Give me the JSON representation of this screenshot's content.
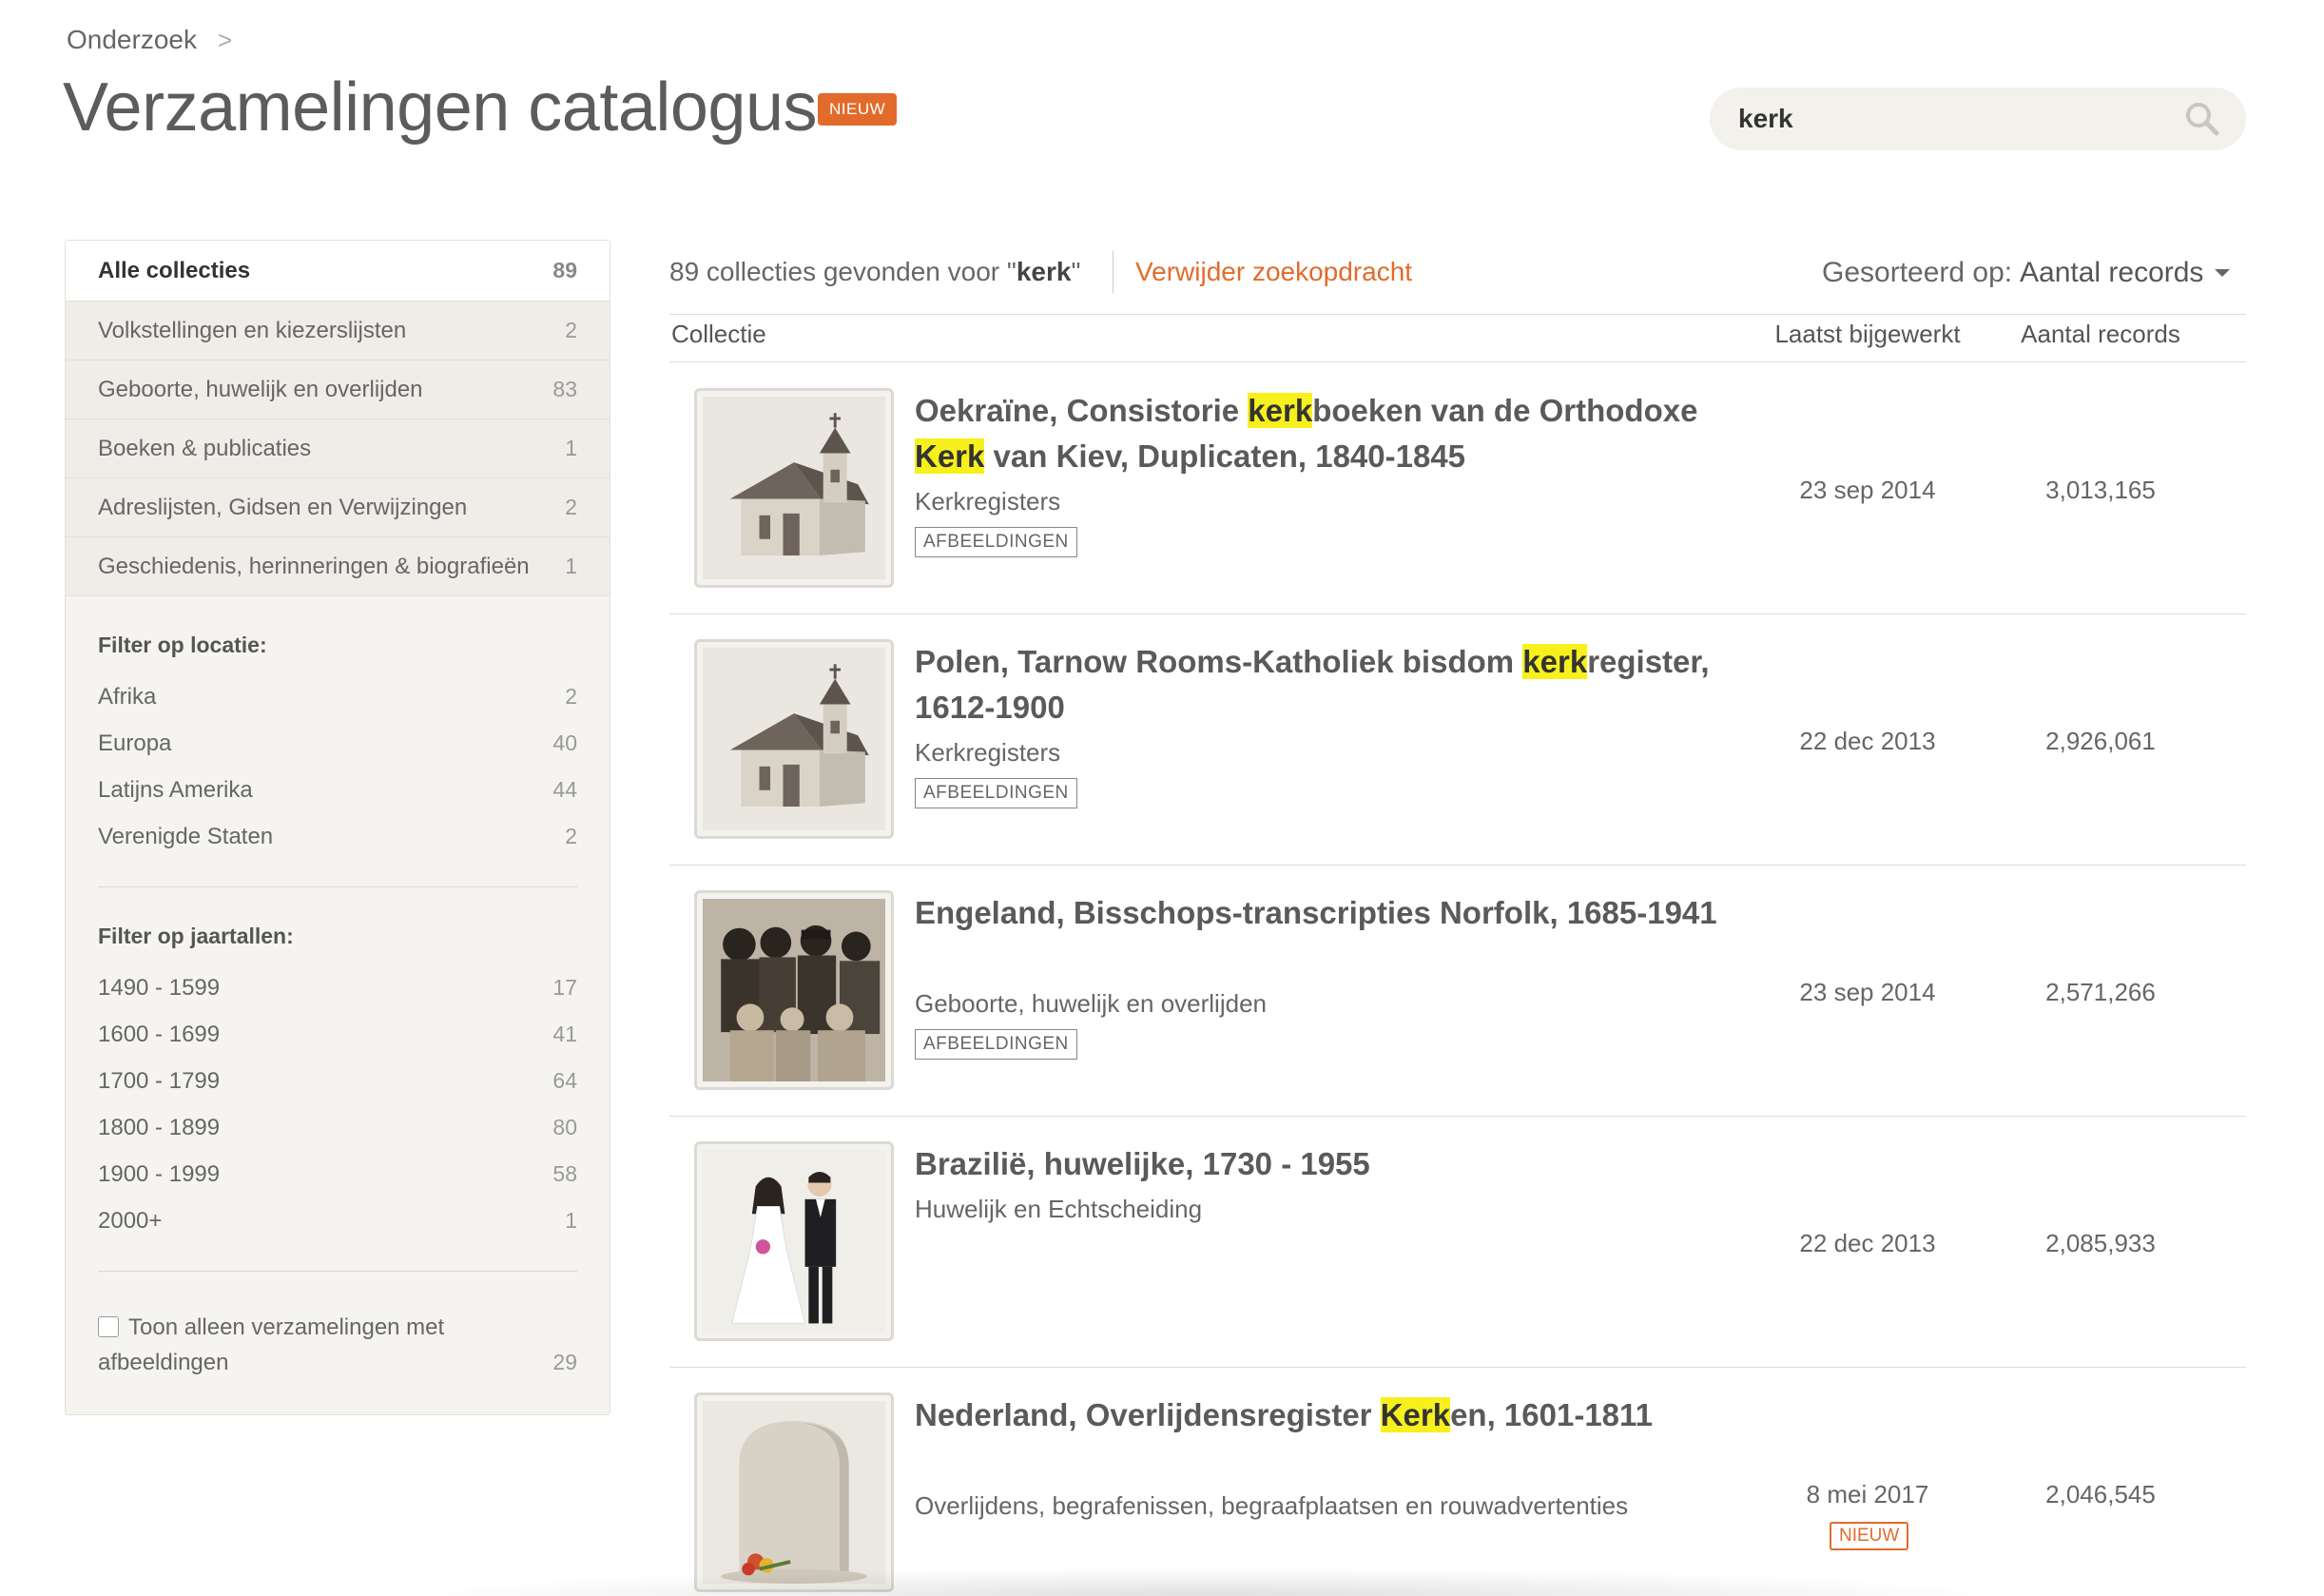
{
  "breadcrumb": {
    "label": "Onderzoek",
    "separator": ">"
  },
  "page": {
    "title": "Verzamelingen catalogus",
    "badge": "NIEUW"
  },
  "search": {
    "value": "kerk",
    "placeholder": ""
  },
  "sidebar": {
    "categories": [
      {
        "label": "Alle collecties",
        "count": "89"
      },
      {
        "label": "Volkstellingen en kiezerslijsten",
        "count": "2"
      },
      {
        "label": "Geboorte, huwelijk en overlijden",
        "count": "83"
      },
      {
        "label": "Boeken & publicaties",
        "count": "1"
      },
      {
        "label": "Adreslijsten, Gidsen en Verwijzingen",
        "count": "2"
      },
      {
        "label": "Geschiedenis, herinneringen & biografieën",
        "count": "1"
      }
    ],
    "location_heading": "Filter op locatie:",
    "locations": [
      {
        "label": "Afrika",
        "count": "2"
      },
      {
        "label": "Europa",
        "count": "40"
      },
      {
        "label": "Latijns Amerika",
        "count": "44"
      },
      {
        "label": "Verenigde Staten",
        "count": "2"
      }
    ],
    "years_heading": "Filter op jaartallen:",
    "years": [
      {
        "label": "1490 - 1599",
        "count": "17"
      },
      {
        "label": "1600 - 1699",
        "count": "41"
      },
      {
        "label": "1700 - 1799",
        "count": "64"
      },
      {
        "label": "1800 - 1899",
        "count": "80"
      },
      {
        "label": "1900 - 1999",
        "count": "58"
      },
      {
        "label": "2000+",
        "count": "1"
      }
    ],
    "images_only": {
      "line1": "Toon alleen verzamelingen met",
      "line2": "afbeeldingen",
      "count": "29"
    }
  },
  "results": {
    "count_prefix": "89 collecties gevonden voor \"",
    "query": "kerk",
    "count_suffix": "\"",
    "clear_label": "Verwijder zoekopdracht",
    "sort_label": "Gesorteerd op:",
    "sort_value": "Aantal records",
    "columns": {
      "collection": "Collectie",
      "updated": "Laatst bijgewerkt",
      "records": "Aantal records"
    },
    "rows": [
      {
        "title_parts": [
          {
            "text": "Oekraïne, Consistorie "
          },
          {
            "text": "kerk",
            "hl": true
          },
          {
            "text": "boeken van de Orthodoxe "
          },
          {
            "text": "Kerk",
            "hl": true
          },
          {
            "text": " van Kiev, Duplicaten, 1840-1845"
          }
        ],
        "subtitle": "Kerkregisters",
        "tag": "AFBEELDINGEN",
        "updated": "23 sep 2014",
        "records": "3,013,165",
        "icon": "church-icon"
      },
      {
        "title_parts": [
          {
            "text": "Polen, Tarnow Rooms-Katholiek bisdom "
          },
          {
            "text": "kerk",
            "hl": true
          },
          {
            "text": "register, 1612-1900"
          }
        ],
        "subtitle": "Kerkregisters",
        "tag": "AFBEELDINGEN",
        "updated": "22 dec 2013",
        "records": "2,926,061",
        "icon": "church-icon"
      },
      {
        "title_parts": [
          {
            "text": "Engeland, Bisschops-transcripties Norfolk, 1685-1941"
          }
        ],
        "subtitle": "Geboorte, huwelijk en overlijden",
        "tag": "AFBEELDINGEN",
        "updated": "23 sep 2014",
        "records": "2,571,266",
        "icon": "family-photo-icon"
      },
      {
        "title_parts": [
          {
            "text": "Brazilië, huwelijke, 1730 - 1955"
          }
        ],
        "subtitle": "Huwelijk en Echtscheiding",
        "tag": "",
        "updated": "22 dec 2013",
        "records": "2,085,933",
        "icon": "wedding-couple-icon"
      },
      {
        "title_parts": [
          {
            "text": "Nederland, Overlijdensregister "
          },
          {
            "text": "Kerk",
            "hl": true
          },
          {
            "text": "en, 1601-1811"
          }
        ],
        "subtitle": "Overlijdens, begrafenissen, begraafplaatsen en rouwadvertenties",
        "tag": "",
        "updated": "8 mei 2017",
        "records": "2,046,545",
        "new_badge": "NIEUW",
        "icon": "gravestone-icon"
      }
    ]
  },
  "colors": {
    "accent": "#e26b2b",
    "highlight": "#f7f01d",
    "sidebar_bg": "#f6f4f0",
    "search_bg": "#f3f1eb"
  }
}
